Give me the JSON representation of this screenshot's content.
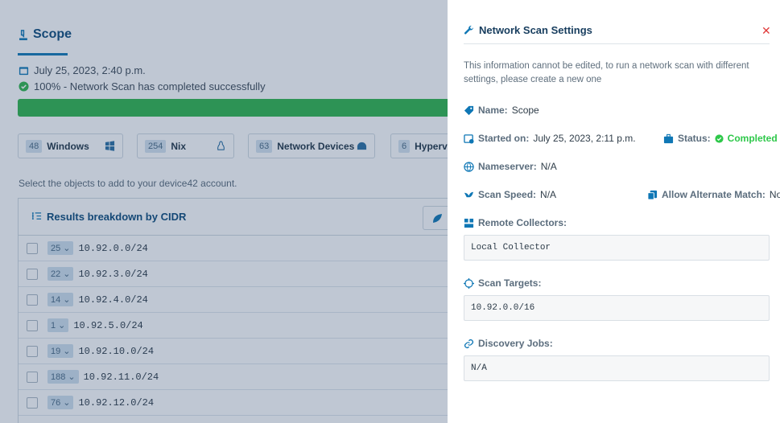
{
  "page": {
    "title": "Scope",
    "date": "July 25, 2023, 2:40 p.m.",
    "status": "100% - Network Scan has completed successfully",
    "progress": 100,
    "os_cards": [
      {
        "count": "48",
        "label": "Windows"
      },
      {
        "count": "254",
        "label": "Nix"
      },
      {
        "count": "63",
        "label": "Network Devices"
      },
      {
        "count": "6",
        "label": "Hypervis"
      }
    ],
    "hint": "Select the objects to add to your device42 account.",
    "results_title": "Results breakdown by CIDR",
    "rows": [
      {
        "count": "25",
        "cidr": "10.92.0.0/24"
      },
      {
        "count": "22",
        "cidr": "10.92.3.0/24"
      },
      {
        "count": "14",
        "cidr": "10.92.4.0/24"
      },
      {
        "count": "1",
        "cidr": "10.92.5.0/24"
      },
      {
        "count": "19",
        "cidr": "10.92.10.0/24"
      },
      {
        "count": "188",
        "cidr": "10.92.11.0/24"
      },
      {
        "count": "76",
        "cidr": "10.92.12.0/24"
      }
    ]
  },
  "panel": {
    "title": "Network Scan Settings",
    "close": "✕",
    "info": "This information cannot be edited, to run a network scan with different settings, please create a new one",
    "name_label": "Name:",
    "name_value": "Scope",
    "started_label": "Started on:",
    "started_value": "July 25, 2023, 2:11 p.m.",
    "status_label": "Status:",
    "status_value": "Completed",
    "nameserver_label": "Nameserver:",
    "nameserver_value": "N/A",
    "speed_label": "Scan Speed:",
    "speed_value": "N/A",
    "alt_label": "Allow Alternate Match:",
    "alt_value": "No",
    "collectors_label": "Remote Collectors:",
    "collectors_value": "Local Collector",
    "targets_label": "Scan Targets:",
    "targets_value": "10.92.0.0/16",
    "jobs_label": "Discovery Jobs:",
    "jobs_value": "N/A"
  },
  "colors": {
    "accent": "#0f77b5",
    "success": "#2ec84a",
    "danger": "#e03a3a",
    "overlay": "#2c466c"
  }
}
